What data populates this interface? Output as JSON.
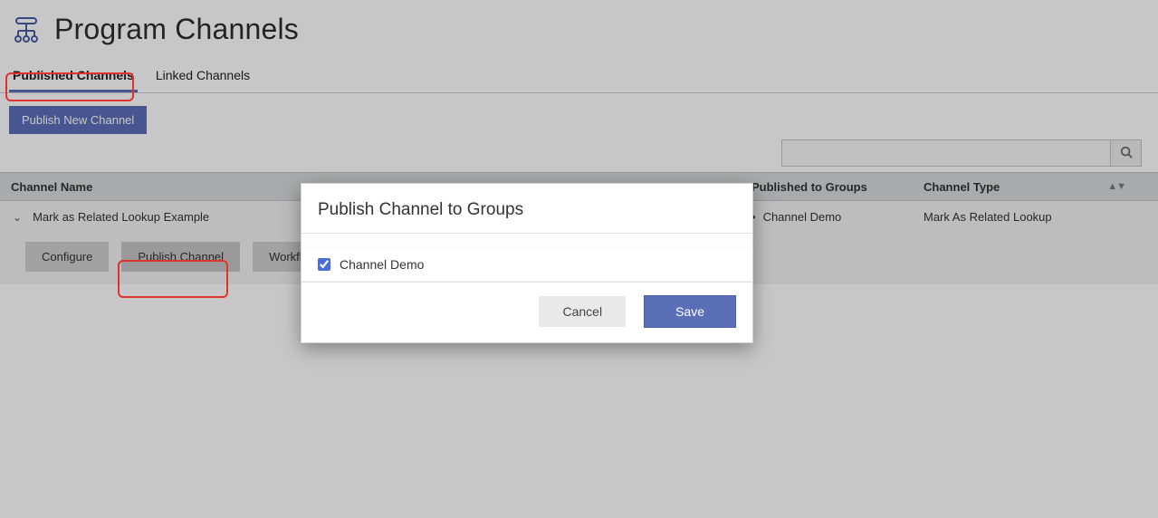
{
  "header": {
    "title": "Program Channels"
  },
  "tabs": {
    "published": "Published Channels",
    "linked": "Linked Channels"
  },
  "toolbar": {
    "publish_new": "Publish New Channel"
  },
  "search": {
    "placeholder": ""
  },
  "table": {
    "columns": {
      "name": "Channel Name",
      "groups": "Published to Groups",
      "type": "Channel Type"
    },
    "row": {
      "name": "Mark as Related Lookup Example",
      "group_item": "Channel Demo",
      "type": "Mark As Related Lookup",
      "actions": {
        "configure": "Configure",
        "publish": "Publish Channel",
        "workflow": "Workflow Settings"
      }
    }
  },
  "modal": {
    "title": "Publish Channel to Groups",
    "group_option": "Channel Demo",
    "cancel": "Cancel",
    "save": "Save"
  }
}
